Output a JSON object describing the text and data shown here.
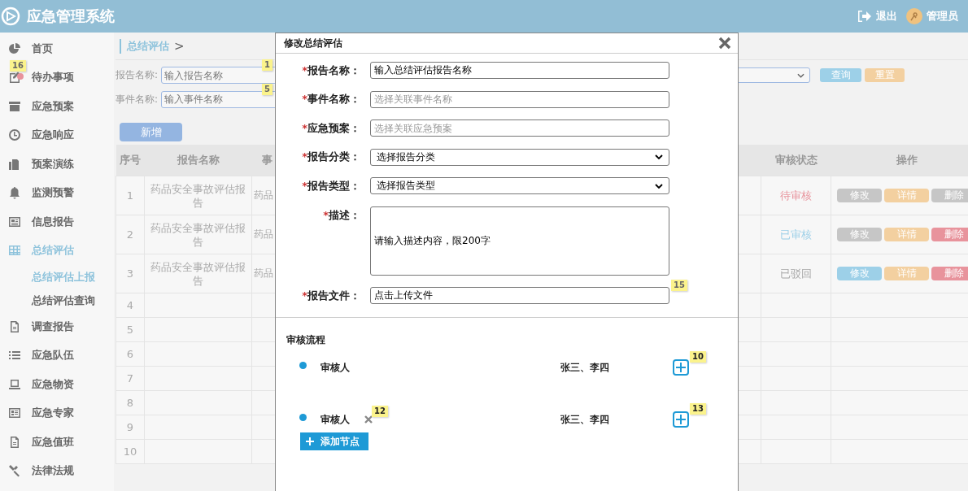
{
  "header": {
    "title": "应急管理系统",
    "logout": "退出",
    "user": "管理员"
  },
  "sidebar": {
    "items": [
      {
        "label": "首页",
        "selected": false,
        "unread": false
      },
      {
        "label": "待办事项",
        "selected": false,
        "unread": true,
        "hint": "16"
      },
      {
        "label": "应急预案",
        "selected": false,
        "unread": false
      },
      {
        "label": "应急响应",
        "selected": false,
        "unread": false
      },
      {
        "label": "预案演练",
        "selected": false,
        "unread": false
      },
      {
        "label": "监测预警",
        "selected": false,
        "unread": false
      },
      {
        "label": "信息报告",
        "selected": false,
        "unread": false
      },
      {
        "label": "总结评估",
        "selected": true,
        "unread": false,
        "children": [
          {
            "label": "总结评估上报",
            "selected": true
          },
          {
            "label": "总结评估查询",
            "selected": false
          }
        ]
      },
      {
        "label": "调查报告",
        "selected": false,
        "unread": false
      },
      {
        "label": "应急队伍",
        "selected": false,
        "unread": false
      },
      {
        "label": "应急物资",
        "selected": false,
        "unread": false
      },
      {
        "label": "应急专家",
        "selected": false,
        "unread": false
      },
      {
        "label": "应急值班",
        "selected": false,
        "unread": false
      },
      {
        "label": "法律法规",
        "selected": false,
        "unread": false
      }
    ]
  },
  "breadcrumb": {
    "current": "总结评估",
    "separator": ">"
  },
  "filters": [
    {
      "label": "报告名称:",
      "placeholder": "输入报告名称",
      "hint": "1"
    },
    {
      "label": "事件名称:",
      "placeholder": "输入事件名称",
      "hint": "5"
    }
  ],
  "search_button": "查询",
  "reset_button": "重置",
  "add_button": "新增",
  "table": {
    "columns": {
      "index": "序号",
      "name": "报告名称",
      "column_3": "事",
      "status": "审核状态",
      "actions": "操作"
    },
    "rows": [
      {
        "index": "1",
        "name": "药品安全事故评估报告",
        "column_3": "药品",
        "status": "待审核",
        "color": "#e8939c",
        "actions": [
          {
            "kind": "edit",
            "label": "修改",
            "disabled": true
          },
          {
            "kind": "detail",
            "label": "详情",
            "disabled": false
          },
          {
            "kind": "delete",
            "label": "删除",
            "disabled": true
          }
        ]
      },
      {
        "index": "2",
        "name": "药品安全事故评估报告",
        "column_3": "药品",
        "status": "已审核",
        "color": "#9dd0e8",
        "actions": [
          {
            "kind": "edit",
            "label": "修改",
            "disabled": true
          },
          {
            "kind": "detail",
            "label": "详情",
            "disabled": false
          },
          {
            "kind": "delete",
            "label": "删除",
            "disabled": false
          }
        ]
      },
      {
        "index": "3",
        "name": "药品安全事故评估报告",
        "column_3": "药品",
        "status": "已驳回",
        "color": "#a8a8a8",
        "actions": [
          {
            "kind": "edit",
            "label": "修改",
            "disabled": false
          },
          {
            "kind": "detail",
            "label": "详情",
            "disabled": false
          },
          {
            "kind": "delete",
            "label": "删除",
            "disabled": false
          }
        ]
      },
      {
        "index": "4"
      },
      {
        "index": "5"
      },
      {
        "index": "6"
      },
      {
        "index": "7"
      },
      {
        "index": "8"
      },
      {
        "index": "9"
      },
      {
        "index": "10"
      }
    ]
  },
  "modal": {
    "title": "修改总结评估",
    "required_mark": "*",
    "fields": [
      {
        "kind": "input",
        "label": "报告名称：",
        "required": true,
        "value": "输入总结评估报告名称"
      },
      {
        "kind": "input",
        "label": "事件名称：",
        "required": true,
        "placeholder": "选择关联事件名称"
      },
      {
        "kind": "input",
        "label": "应急预案：",
        "required": true,
        "placeholder": "选择关联应急预案"
      },
      {
        "kind": "select",
        "label": "报告分类：",
        "required": true,
        "value": "选择报告分类"
      },
      {
        "kind": "select",
        "label": "报告类型：",
        "required": true,
        "value": "选择报告类型"
      },
      {
        "kind": "textarea",
        "label": "描述：",
        "required": true,
        "value": "请输入描述内容，限200字"
      },
      {
        "kind": "input",
        "label": "报告文件：",
        "required": true,
        "value": "点击上传文件",
        "hint": "15"
      }
    ],
    "review": {
      "title": "审核流程",
      "nodes": [
        {
          "label": "审核人",
          "reviewers": "张三、李四",
          "removable": false,
          "hint": "10"
        },
        {
          "label": "审核人",
          "reviewers": "张三、李四",
          "removable": true,
          "remove_hint": "12",
          "hint": "13"
        }
      ],
      "add_node": "添加节点"
    }
  }
}
